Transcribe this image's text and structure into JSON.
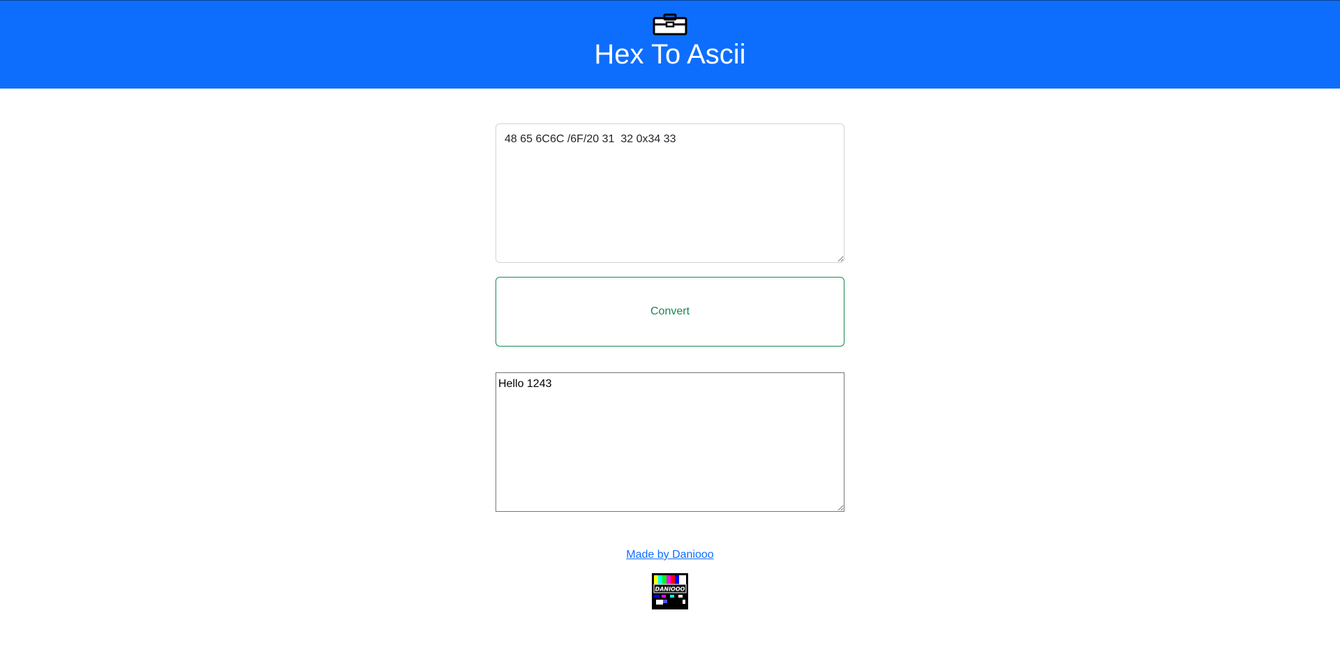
{
  "header": {
    "title": "Hex To Ascii",
    "icon": "toolbox-icon"
  },
  "main": {
    "input_value": "48 65 6C6C /6F/20 31  32 0x34 33",
    "convert_label": "Convert",
    "output_value": "Hello 1243"
  },
  "footer": {
    "link_text": "Made by Daniooo",
    "logo_text": "DANIOOO"
  },
  "colors": {
    "header_bg": "#0d6efd",
    "button_accent": "#198754",
    "link": "#0d6efd"
  }
}
